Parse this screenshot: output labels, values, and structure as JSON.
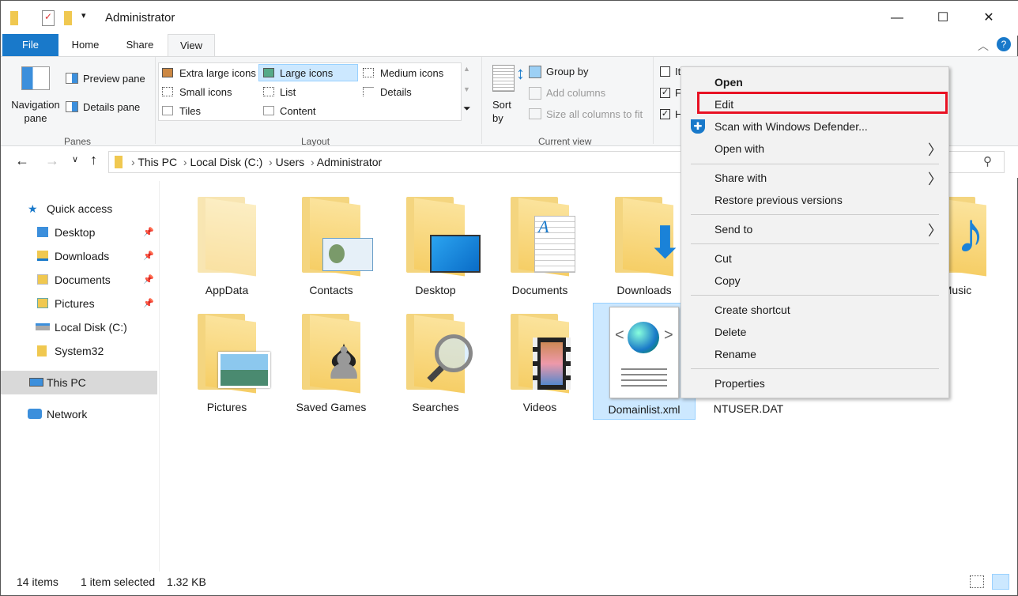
{
  "window": {
    "title": "Administrator",
    "minimize": "—",
    "maximize": "☐",
    "close": "✕"
  },
  "tabs": [
    {
      "label": "File"
    },
    {
      "label": "Home"
    },
    {
      "label": "Share"
    },
    {
      "label": "View"
    }
  ],
  "ribbon": {
    "panes": {
      "navigation_pane": "Navigation pane",
      "preview_pane": "Preview pane",
      "details_pane": "Details pane",
      "group": "Panes"
    },
    "layout": {
      "items": [
        "Extra large icons",
        "Large icons",
        "Medium icons",
        "Small icons",
        "List",
        "Details",
        "Tiles",
        "Content"
      ],
      "selected": "Large icons",
      "group": "Layout"
    },
    "current_view": {
      "sort_by": "Sort by",
      "group_by": "Group by",
      "add_columns": "Add columns",
      "size_columns": "Size all columns to fit",
      "group": "Current view"
    },
    "show_hide": {
      "checkboxes": [
        {
          "label": "It",
          "checked": false
        },
        {
          "label": "F",
          "checked": true
        },
        {
          "label": "H",
          "checked": true
        }
      ]
    }
  },
  "address": {
    "path": [
      "This PC",
      "Local Disk (C:)",
      "Users",
      "Administrator"
    ]
  },
  "nav": {
    "items": [
      {
        "label": "Quick access",
        "pinned": false
      },
      {
        "label": "Desktop",
        "pinned": true
      },
      {
        "label": "Downloads",
        "pinned": true
      },
      {
        "label": "Documents",
        "pinned": true
      },
      {
        "label": "Pictures",
        "pinned": true
      },
      {
        "label": "Local Disk (C:)",
        "pinned": false
      },
      {
        "label": "System32",
        "pinned": false
      },
      {
        "label": "This PC",
        "pinned": false,
        "selected": true
      },
      {
        "label": "Network",
        "pinned": false
      }
    ]
  },
  "files": [
    {
      "name": "AppData"
    },
    {
      "name": "Contacts"
    },
    {
      "name": "Desktop"
    },
    {
      "name": "Documents"
    },
    {
      "name": "Downloads"
    },
    {
      "name": "Music"
    },
    {
      "name": "Pictures"
    },
    {
      "name": "Saved Games"
    },
    {
      "name": "Searches"
    },
    {
      "name": "Videos"
    },
    {
      "name": "Domainlist.xml",
      "selected": true
    },
    {
      "name": "NTUSER.DAT"
    }
  ],
  "context_menu": {
    "items": [
      "Open",
      "Edit",
      "Scan with Windows Defender...",
      "Open with",
      "Share with",
      "Restore previous versions",
      "Send to",
      "Cut",
      "Copy",
      "Create shortcut",
      "Delete",
      "Rename",
      "Properties"
    ],
    "highlighted": "Edit",
    "highlight_color": "#e81123"
  },
  "status": {
    "count": "14 items",
    "selection": "1 item selected",
    "size": "1.32 KB"
  },
  "colors": {
    "accent": "#1979ca",
    "selection": "#cce8ff"
  }
}
